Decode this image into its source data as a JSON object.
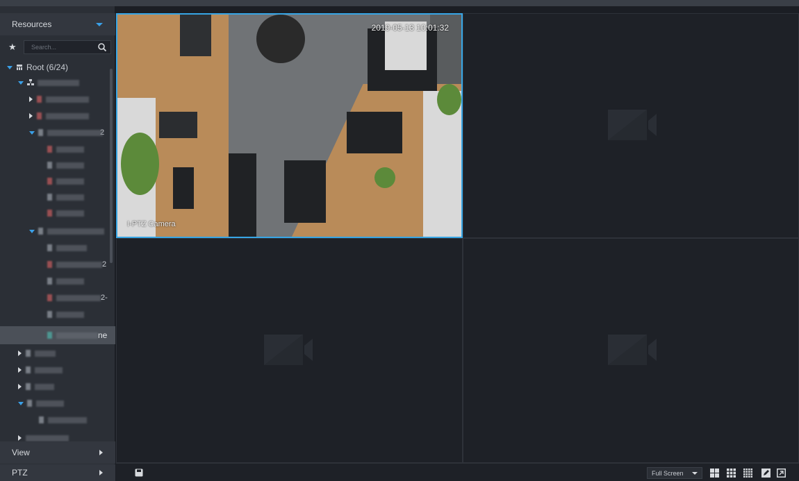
{
  "sidebar": {
    "resources_label": "Resources",
    "search_placeholder": "Search...",
    "root_label": "Root (6/24)",
    "view_label": "View",
    "ptz_label": "PTZ",
    "selected_suffix": "ne",
    "tree_suffixes": [
      "2",
      "2",
      "2-"
    ]
  },
  "video": {
    "timestamp": "2019-05-13 10:01:32",
    "camera_name": "I-PTZ Camera"
  },
  "toolbar": {
    "fullscreen_label": "Full Screen"
  },
  "colors": {
    "accent": "#37a6e6",
    "sidebar_bg": "#2b2f36",
    "pane_bg": "#1e2127"
  }
}
